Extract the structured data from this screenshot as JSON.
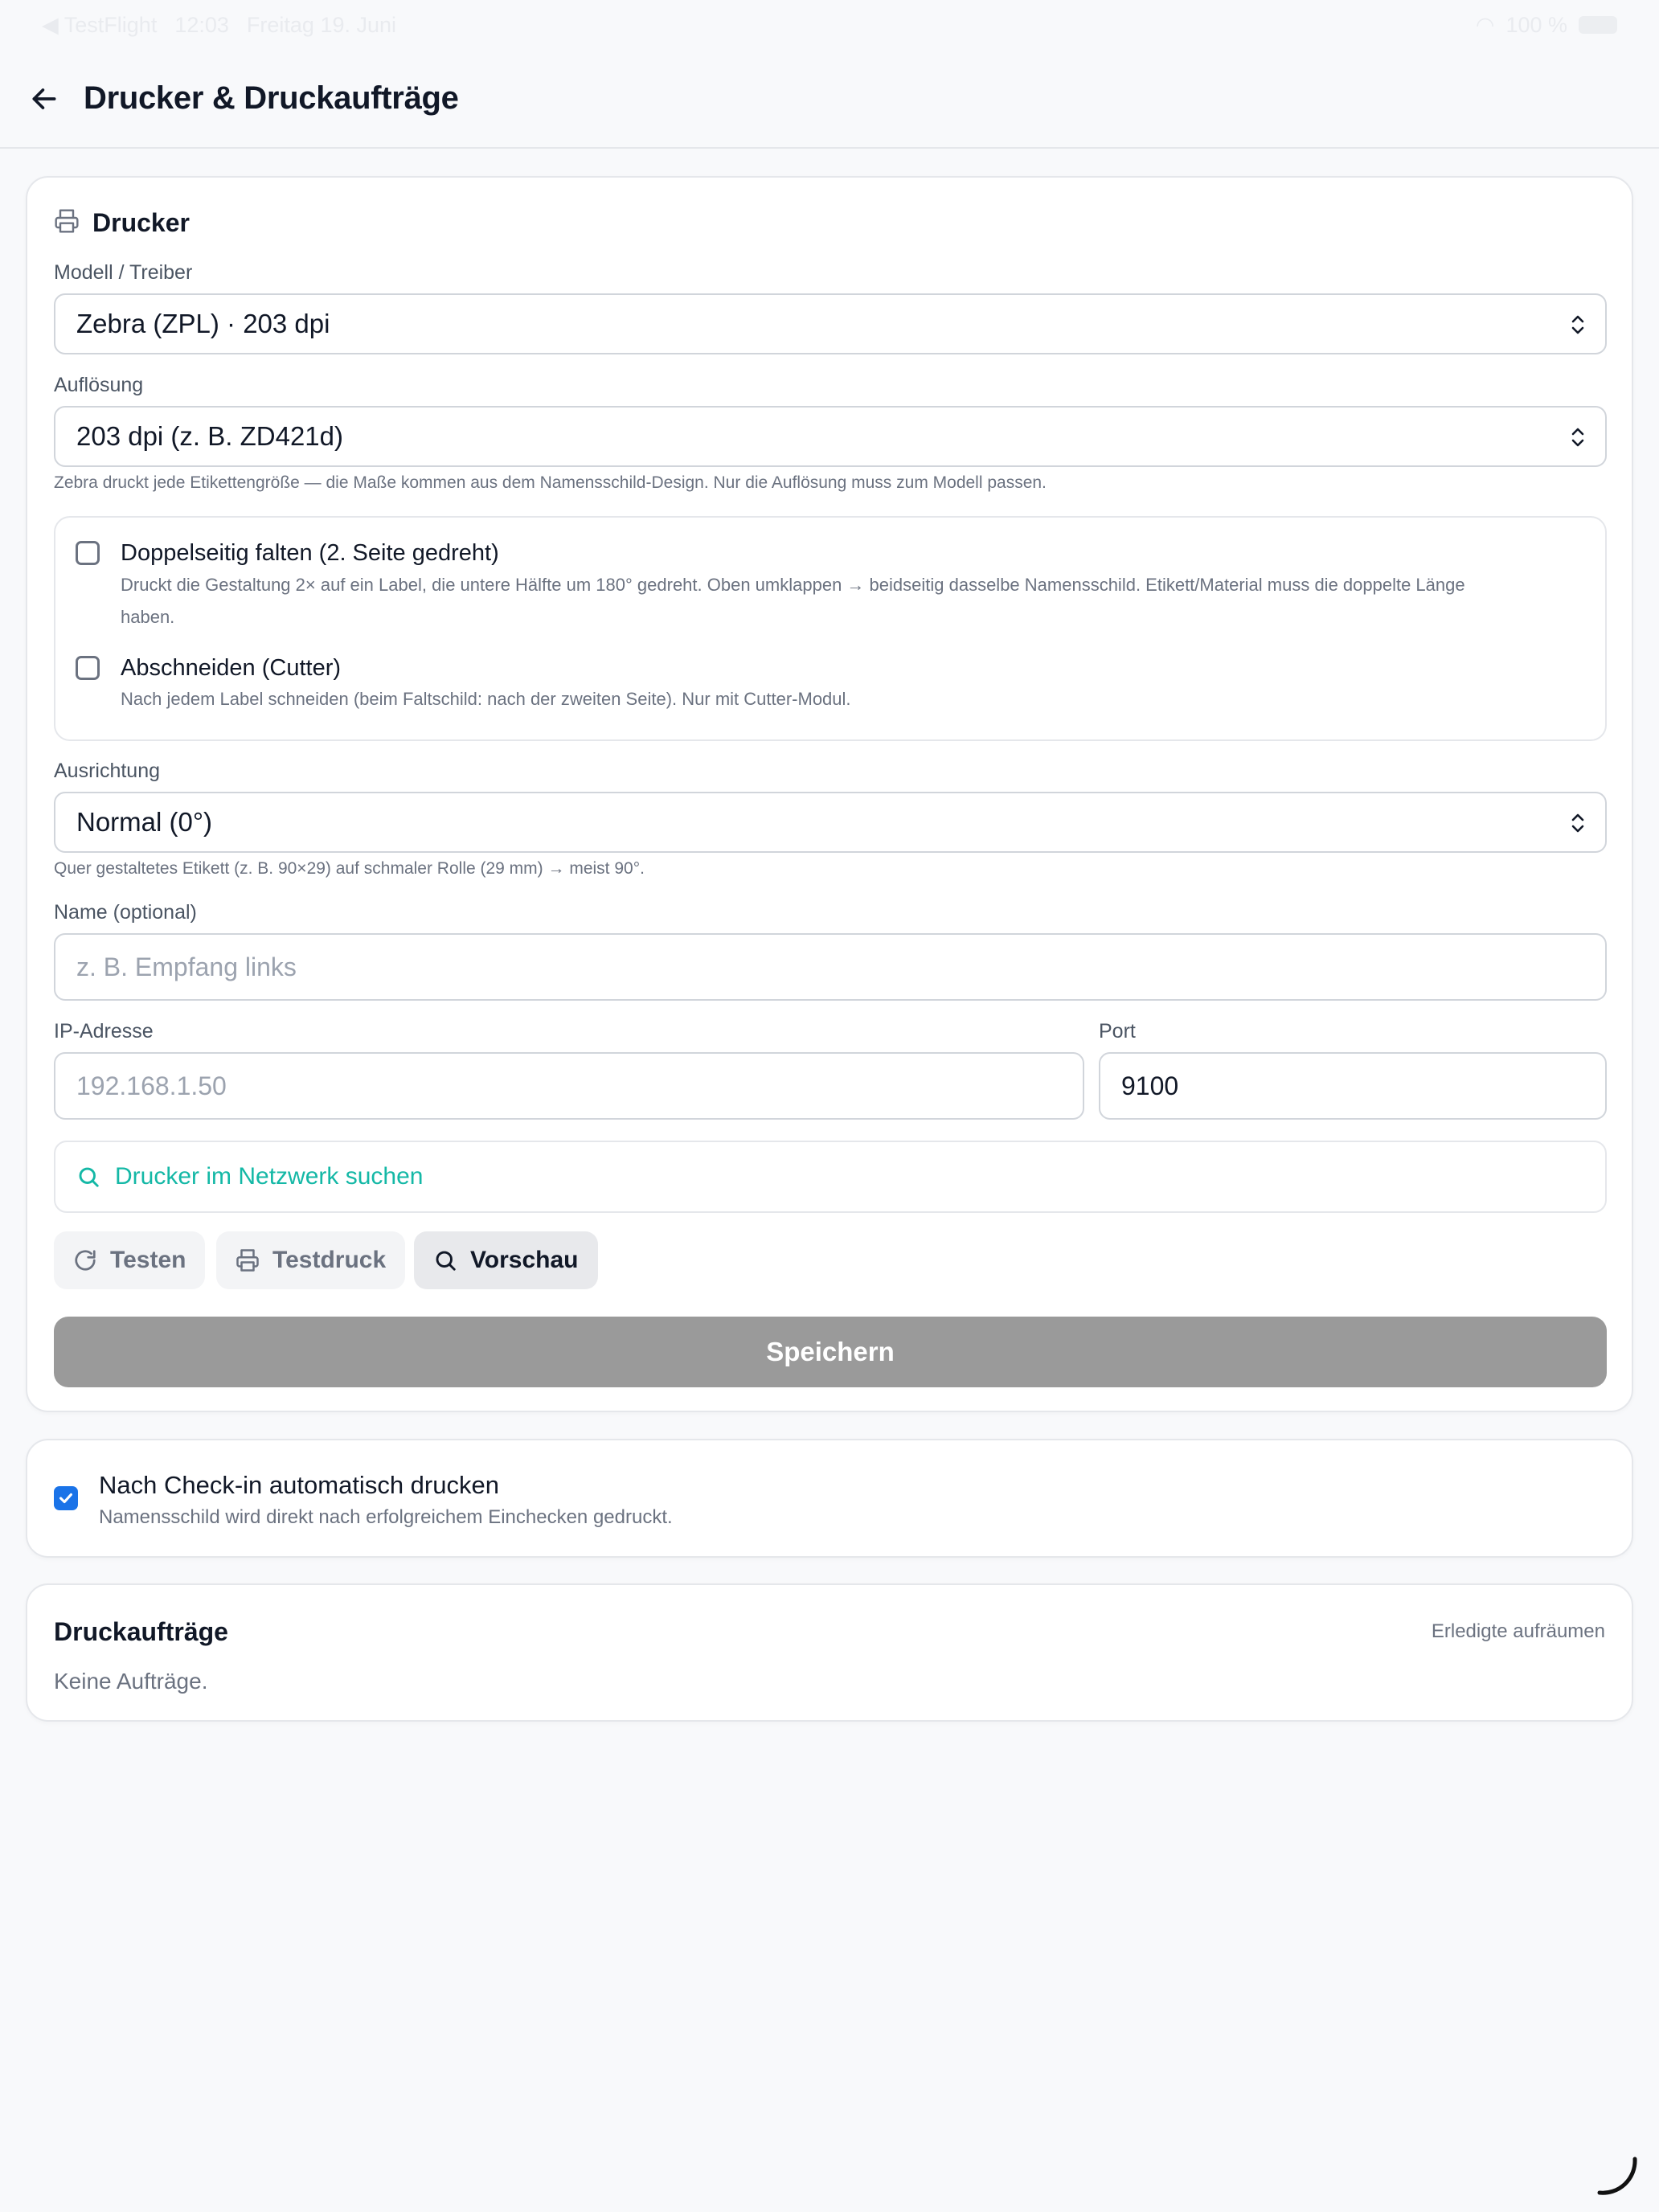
{
  "status_bar": {
    "back_app": "◀ TestFlight",
    "time": "12:03",
    "date": "Freitag 19. Juni",
    "battery": "100 %"
  },
  "header": {
    "title": "Drucker & Druckaufträge"
  },
  "printer": {
    "section_title": "Drucker",
    "model_label": "Modell / Treiber",
    "model_value": "Zebra (ZPL) · 203 dpi",
    "resolution_label": "Auflösung",
    "resolution_value": "203 dpi (z. B. ZD421d)",
    "resolution_hint": "Zebra druckt jede Etikettengröße — die Maße kommen aus dem Namensschild-Design. Nur die Auflösung muss zum Modell passen.",
    "options": [
      {
        "title": "Doppelseitig falten (2. Seite gedreht)",
        "desc_line1": "Druckt die Gestaltung 2× auf ein Label, die untere Hälfte um 180° gedreht. Oben umklappen → beidseitig dasselbe Namensschild. Etikett/Material muss die doppelte Länge",
        "desc_line2": "haben.",
        "checked": false
      },
      {
        "title": "Abschneiden (Cutter)",
        "desc_line1": "Nach jedem Label schneiden (beim Faltschild: nach der zweiten Seite). Nur mit Cutter-Modul.",
        "checked": false
      }
    ],
    "orientation_label": "Ausrichtung",
    "orientation_value": "Normal (0°)",
    "orientation_hint": "Quer gestaltetes Etikett (z. B. 90×29) auf schmaler Rolle (29 mm) → meist 90°.",
    "name_label": "Name (optional)",
    "name_placeholder": "z. B. Empfang links",
    "ip_label": "IP-Adresse",
    "ip_placeholder": "192.168.1.50",
    "port_label": "Port",
    "port_value": "9100",
    "search_label": "Drucker im Netzwerk suchen",
    "test_label": "Testen",
    "testprint_label": "Testdruck",
    "preview_label": "Vorschau",
    "save_label": "Speichern"
  },
  "autoprint": {
    "title": "Nach Check-in automatisch drucken",
    "desc": "Namensschild wird direkt nach erfolgreichem Einchecken gedruckt.",
    "checked": true
  },
  "jobs": {
    "title": "Druckaufträge",
    "clear_label": "Erledigte aufräumen",
    "empty_text": "Keine Aufträge."
  },
  "colors": {
    "accent_teal": "#14b8a6",
    "checkbox_blue": "#1a73e8",
    "save_disabled": "#9a9a9a"
  }
}
